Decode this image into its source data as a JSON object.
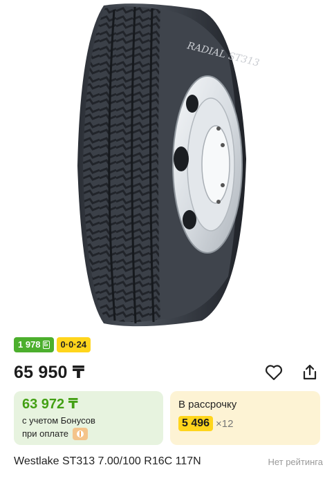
{
  "product": {
    "image_alt": "tire-image",
    "sidewall_text": "RADIAL ST313",
    "title": "Westlake ST313 7.00/100 R16C 117N",
    "rating_text": "Нет рейтинга"
  },
  "badges": {
    "bonus_value": "1 978",
    "bonus_coin": "Б",
    "installment_code": "0·0·24"
  },
  "pricing": {
    "price": "65 950 ₸",
    "bonus_price": "63 972 ₸",
    "bonus_line1": "с учетом Бонусов",
    "bonus_line2": "при оплате",
    "installment_title": "В рассрочку",
    "installment_amount": "5 496",
    "installment_months": "×12"
  },
  "icons": {
    "favorite": "heart-icon",
    "share": "share-icon",
    "payment": "payment-icon"
  },
  "colors": {
    "bonus_green": "#43a014",
    "badge_green": "#4caf2d",
    "accent_yellow": "#ffd51c",
    "bonus_card_bg": "#e7f3df",
    "installment_card_bg": "#fdf3d4"
  }
}
